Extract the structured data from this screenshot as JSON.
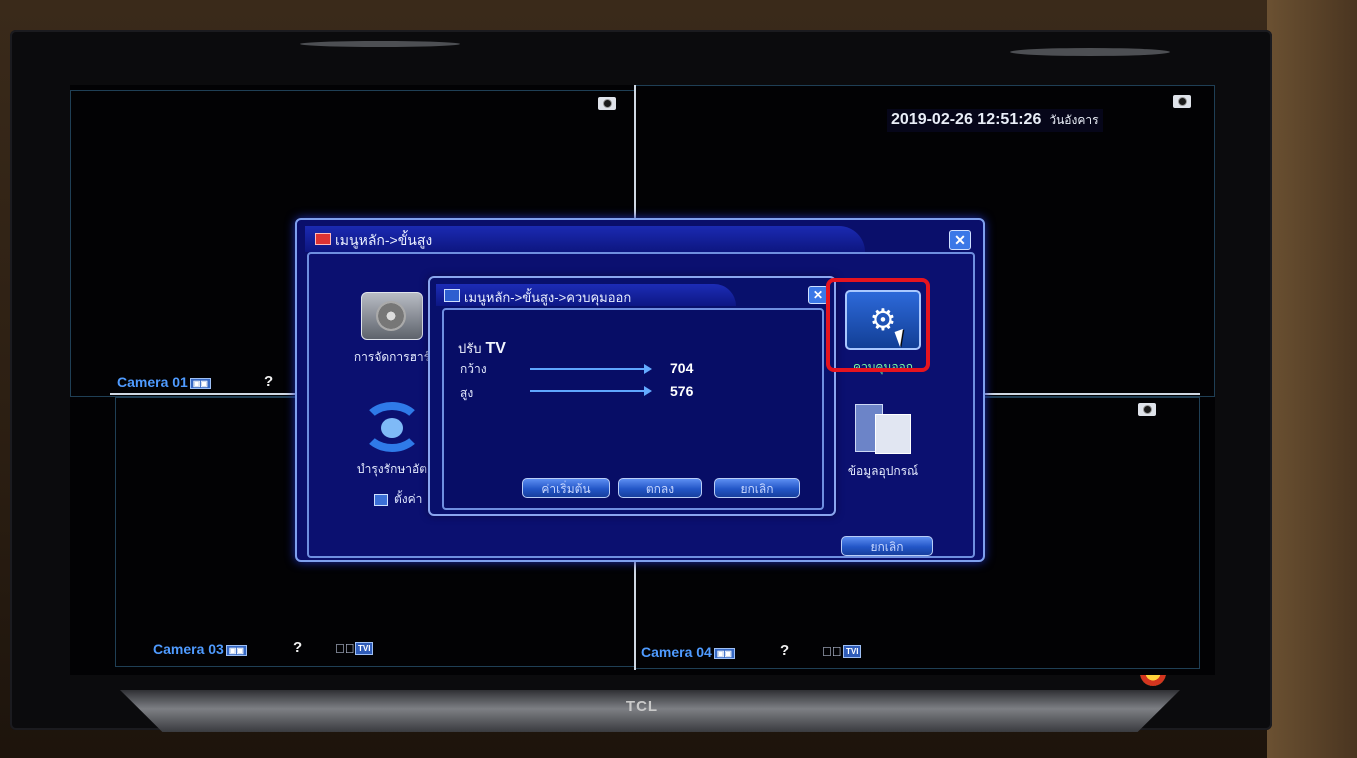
{
  "tv": {
    "brand": "TCL"
  },
  "cameras": [
    {
      "label": "Camera 01",
      "rec": "▣▣"
    },
    {
      "label": "Camera 03",
      "rec": "▣▣"
    },
    {
      "label": "Camera 04",
      "rec": "▣▣"
    }
  ],
  "help_symbol": "?",
  "audio_symbol": "◀ﾞ",
  "tvi_badge": "TVI",
  "datetime": {
    "value": "2019-02-26 12:51:26",
    "day": "วันอังคาร"
  },
  "advanced_menu": {
    "title": "เมนูหลัก->ขั้นสูง",
    "close_symbol": "✕",
    "items": [
      {
        "label": "การจัดการฮาร์",
        "icon": "hdd-icon"
      },
      {
        "label": "บำรุงรักษาอัต",
        "icon": "sync-icon"
      },
      {
        "label": "ควบคุมออก",
        "icon": "gear-icon"
      },
      {
        "label": "ข้อมูลอุปกรณ์",
        "icon": "device-icon"
      }
    ],
    "settings_note": "ตั้งค่า",
    "cancel_label": "ยกเลิก"
  },
  "output_window": {
    "title": "เมนูหลัก->ขั้นสูง->ควบคุมออก",
    "close_symbol": "✕",
    "heading_prefix": "ปรับ",
    "heading_target": "TV",
    "params": [
      {
        "label": "กว้าง",
        "value": "704",
        "level": 1.0
      },
      {
        "label": "สูง",
        "value": "576",
        "level": 1.0
      }
    ],
    "buttons": {
      "default": "ค่าเริ่มต้น",
      "ok": "ตกลง",
      "cancel": "ยกเลิก"
    }
  },
  "colors": {
    "accent": "#3b78e7",
    "window_bg": "#0a0f6b",
    "highlight": "#e6141f",
    "camera_label": "#4f9bff"
  }
}
